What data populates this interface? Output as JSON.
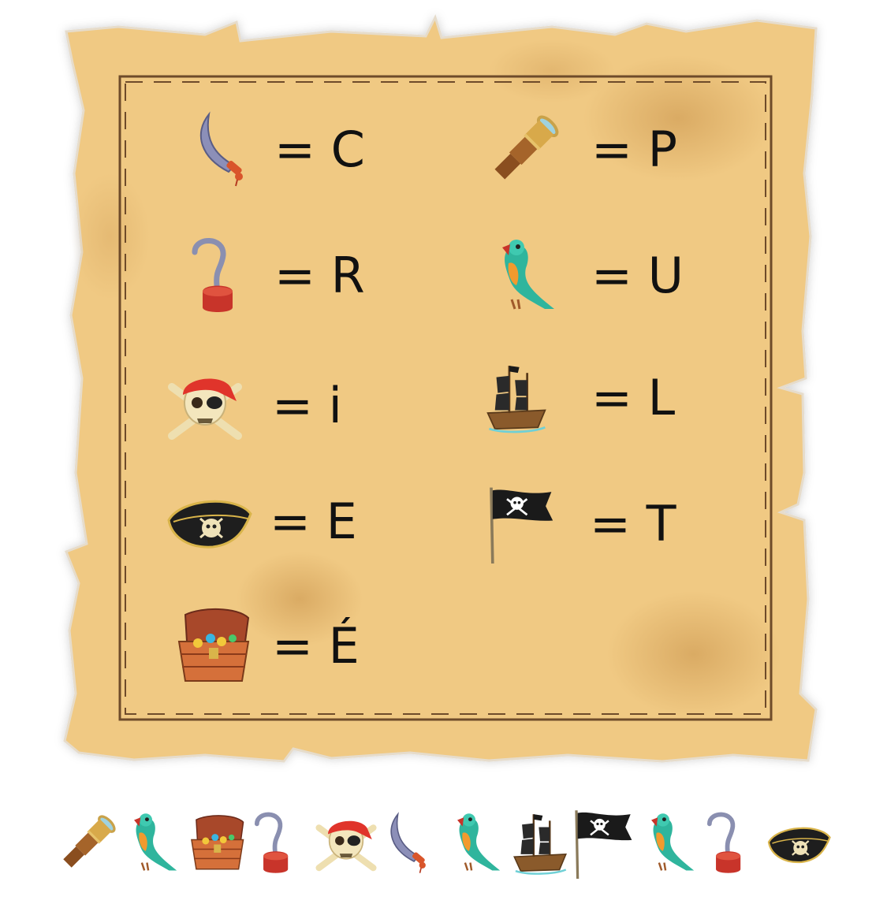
{
  "legend": [
    {
      "icon": "sword-icon",
      "letter": "= C"
    },
    {
      "icon": "spyglass-icon",
      "letter": "= P"
    },
    {
      "icon": "hook-icon",
      "letter": "= R"
    },
    {
      "icon": "parrot-icon",
      "letter": "= U"
    },
    {
      "icon": "skull-crossbones-icon",
      "letter": "= i"
    },
    {
      "icon": "pirate-ship-icon",
      "letter": "= L"
    },
    {
      "icon": "pirate-hat-icon",
      "letter": "= E"
    },
    {
      "icon": "pirate-flag-icon",
      "letter": "=  T"
    },
    {
      "icon": "treasure-chest-icon",
      "letter": "= É"
    }
  ],
  "puzzle": [
    "spyglass-icon",
    "parrot-icon",
    "treasure-chest-icon",
    "hook-icon",
    "skull-crossbones-icon",
    "sword-icon",
    "parrot-icon",
    "pirate-ship-icon",
    "pirate-flag-icon",
    "parrot-icon",
    "hook-icon",
    "pirate-hat-icon"
  ],
  "colors": {
    "parchment": "#f0c983",
    "parchment_edge": "#e2b46a",
    "border": "#6e4b2a",
    "text": "#111111"
  }
}
